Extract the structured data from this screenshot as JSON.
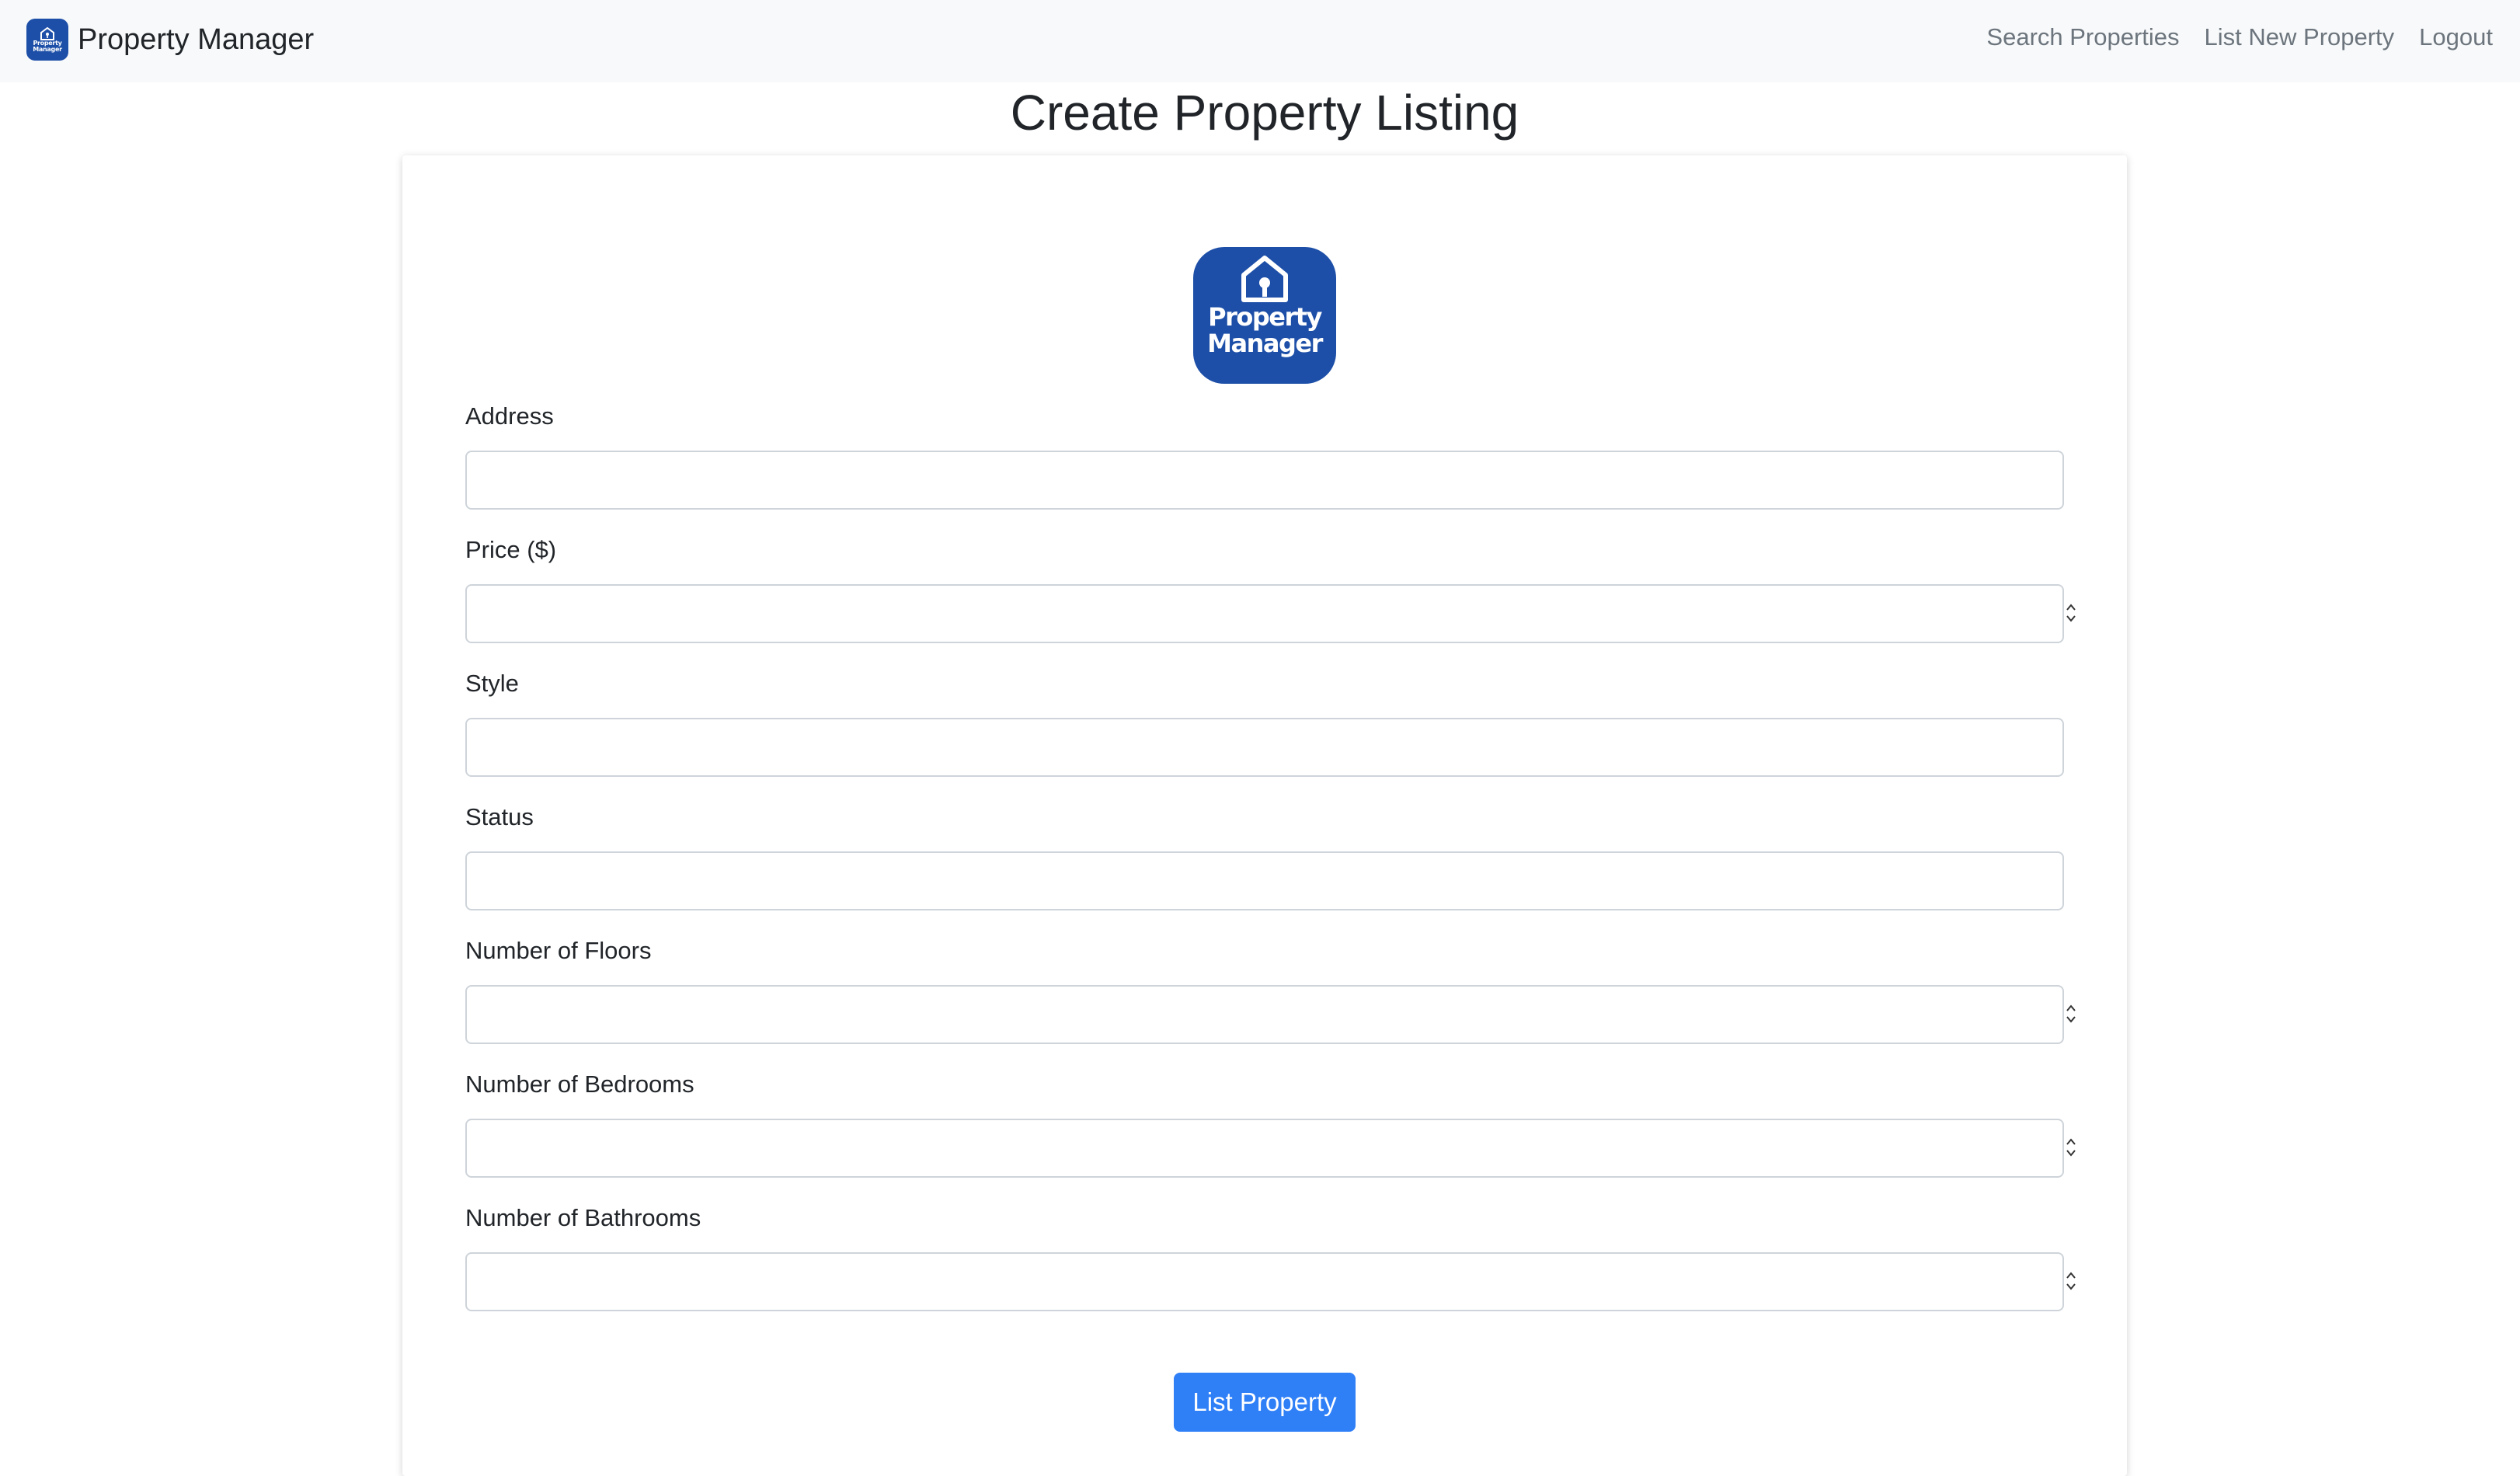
{
  "navbar": {
    "brand_name": "Property Manager",
    "brand_logo_text_line1": "Property",
    "brand_logo_text_line2": "Manager",
    "links": [
      {
        "label": "Search Properties"
      },
      {
        "label": "List New Property"
      },
      {
        "label": "Logout"
      }
    ]
  },
  "page": {
    "title": "Create Property Listing"
  },
  "logo": {
    "line1": "Property",
    "line2": "Manager",
    "icon": "house-keyhole-icon"
  },
  "form": {
    "fields": [
      {
        "label": "Address",
        "type": "text",
        "value": "",
        "placeholder": ""
      },
      {
        "label": "Price ($)",
        "type": "number",
        "value": "",
        "placeholder": ""
      },
      {
        "label": "Style",
        "type": "text",
        "value": "",
        "placeholder": ""
      },
      {
        "label": "Status",
        "type": "text",
        "value": "",
        "placeholder": ""
      },
      {
        "label": "Number of Floors",
        "type": "number",
        "value": "",
        "placeholder": ""
      },
      {
        "label": "Number of Bedrooms",
        "type": "number",
        "value": "",
        "placeholder": ""
      },
      {
        "label": "Number of Bathrooms",
        "type": "number",
        "value": "",
        "placeholder": ""
      }
    ],
    "submit_label": "List Property"
  },
  "colors": {
    "brand_blue": "#1d4fa8",
    "button_blue": "#2f7ff7",
    "navbar_bg": "#f8f9fa",
    "nav_link": "#6c757d"
  }
}
